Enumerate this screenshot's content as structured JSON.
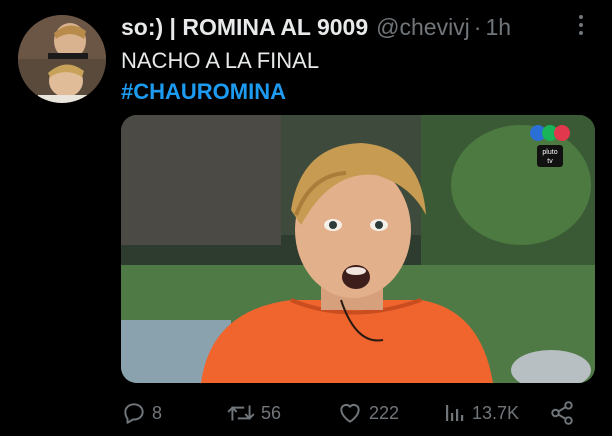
{
  "tweet": {
    "display_name": "so:) | ROMINA AL 9009",
    "handle": "@chevivj",
    "separator": "·",
    "time": "1h",
    "text": "NACHO A LA FINAL",
    "hashtag": "#CHAUROMINA"
  },
  "media": {
    "watermark_text": "pluto tv",
    "dot_colors": [
      "#2b6fd6",
      "#19b35a",
      "#e2384d"
    ]
  },
  "actions": {
    "replies": "8",
    "retweets": "56",
    "likes": "222",
    "views": "13.7K"
  },
  "colors": {
    "background": "#000000",
    "text": "#e7e9ea",
    "muted": "#71767b",
    "accent": "#1d9bf0"
  }
}
